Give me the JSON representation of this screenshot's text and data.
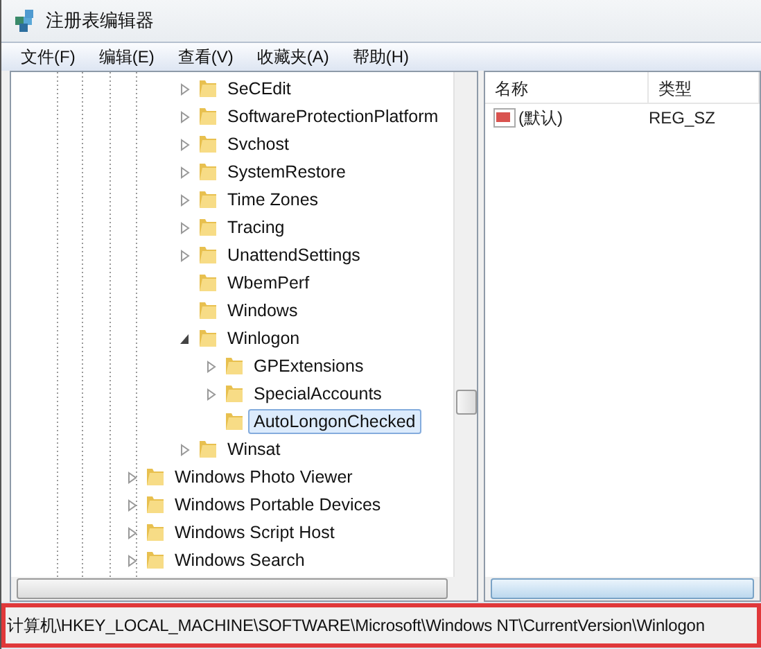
{
  "window": {
    "title": "注册表编辑器"
  },
  "menu": [
    "文件(F)",
    "编辑(E)",
    "查看(V)",
    "收藏夹(A)",
    "帮助(H)"
  ],
  "tree": {
    "items": [
      {
        "children": [
          {
            "label": "SeCEdit",
            "expanded": false,
            "selected": false
          },
          {
            "label": "SoftwareProtectionPlatform",
            "expanded": false,
            "selected": false
          },
          {
            "label": "Svchost",
            "expanded": false,
            "selected": false
          },
          {
            "label": "SystemRestore",
            "expanded": false,
            "selected": false
          },
          {
            "label": "Time Zones",
            "expanded": false,
            "selected": false
          },
          {
            "label": "Tracing",
            "expanded": false,
            "selected": false
          },
          {
            "label": "UnattendSettings",
            "expanded": false,
            "selected": false
          },
          {
            "label": "WbemPerf",
            "selected": false
          },
          {
            "label": "Windows",
            "selected": false
          },
          {
            "label": "Winlogon",
            "expanded": true,
            "selected": false,
            "children": [
              {
                "label": "GPExtensions",
                "expanded": false,
                "selected": false
              },
              {
                "label": "SpecialAccounts",
                "expanded": false,
                "selected": false
              },
              {
                "label": "AutoLongonChecked",
                "selected": true
              }
            ]
          },
          {
            "label": "Winsat",
            "expanded": false,
            "selected": false
          }
        ]
      },
      {
        "label": "Windows Photo Viewer",
        "expanded": false,
        "selected": false
      },
      {
        "label": "Windows Portable Devices",
        "expanded": false,
        "selected": false
      },
      {
        "label": "Windows Script Host",
        "expanded": false,
        "selected": false
      },
      {
        "label": "Windows Search",
        "expanded": false,
        "selected": false
      }
    ]
  },
  "values": {
    "columns": [
      "名称",
      "类型"
    ],
    "rows": [
      {
        "name": "(默认)",
        "type": "REG_SZ"
      }
    ]
  },
  "status_bar": "计算机\\HKEY_LOCAL_MACHINE\\SOFTWARE\\Microsoft\\Windows NT\\CurrentVersion\\Winlogon"
}
